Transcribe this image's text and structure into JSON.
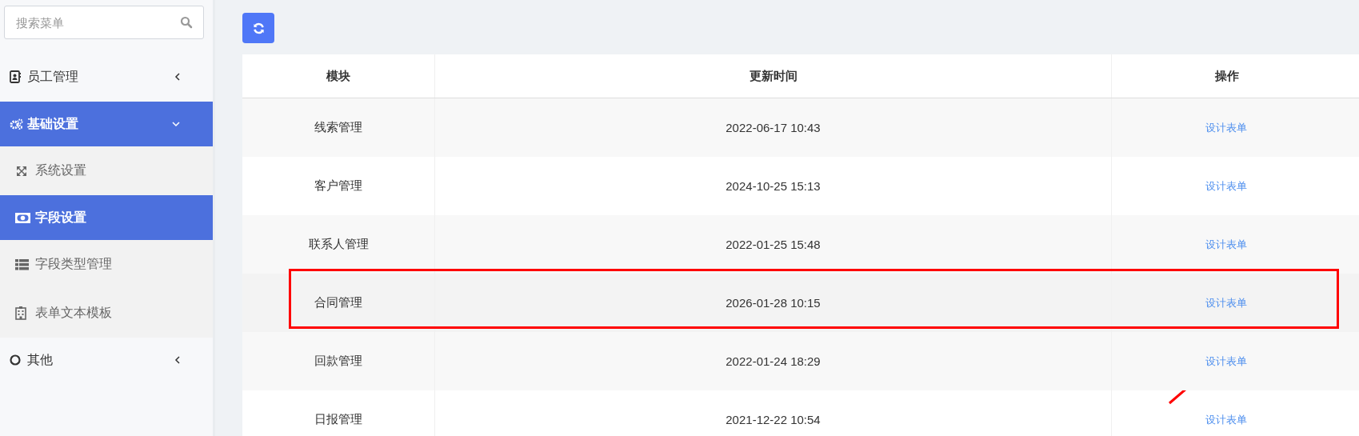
{
  "sidebar": {
    "search": {
      "placeholder": "搜索菜单"
    },
    "items": [
      {
        "label": "员工管理",
        "expanded": false
      },
      {
        "label": "基础设置",
        "expanded": true,
        "children": [
          {
            "label": "系统设置",
            "selected": false
          },
          {
            "label": "字段设置",
            "selected": true
          },
          {
            "label": "字段类型管理",
            "selected": false
          },
          {
            "label": "表单文本模板",
            "selected": false
          }
        ]
      },
      {
        "label": "其他",
        "expanded": false
      }
    ]
  },
  "table": {
    "columns": [
      "模块",
      "更新时间",
      "操作"
    ],
    "rows": [
      {
        "module": "线索管理",
        "updated": "2022-06-17 10:43",
        "action": "设计表单",
        "highlighted": false
      },
      {
        "module": "客户管理",
        "updated": "2024-10-25 15:13",
        "action": "设计表单",
        "highlighted": false
      },
      {
        "module": "联系人管理",
        "updated": "2022-01-25 15:48",
        "action": "设计表单",
        "highlighted": false
      },
      {
        "module": "合同管理",
        "updated": "2026-01-28 10:15",
        "action": "设计表单",
        "highlighted": true
      },
      {
        "module": "回款管理",
        "updated": "2022-01-24 18:29",
        "action": "设计表单",
        "highlighted": false
      },
      {
        "module": "日报管理",
        "updated": "2021-12-22 10:54",
        "action": "设计表单",
        "highlighted": false
      }
    ]
  }
}
